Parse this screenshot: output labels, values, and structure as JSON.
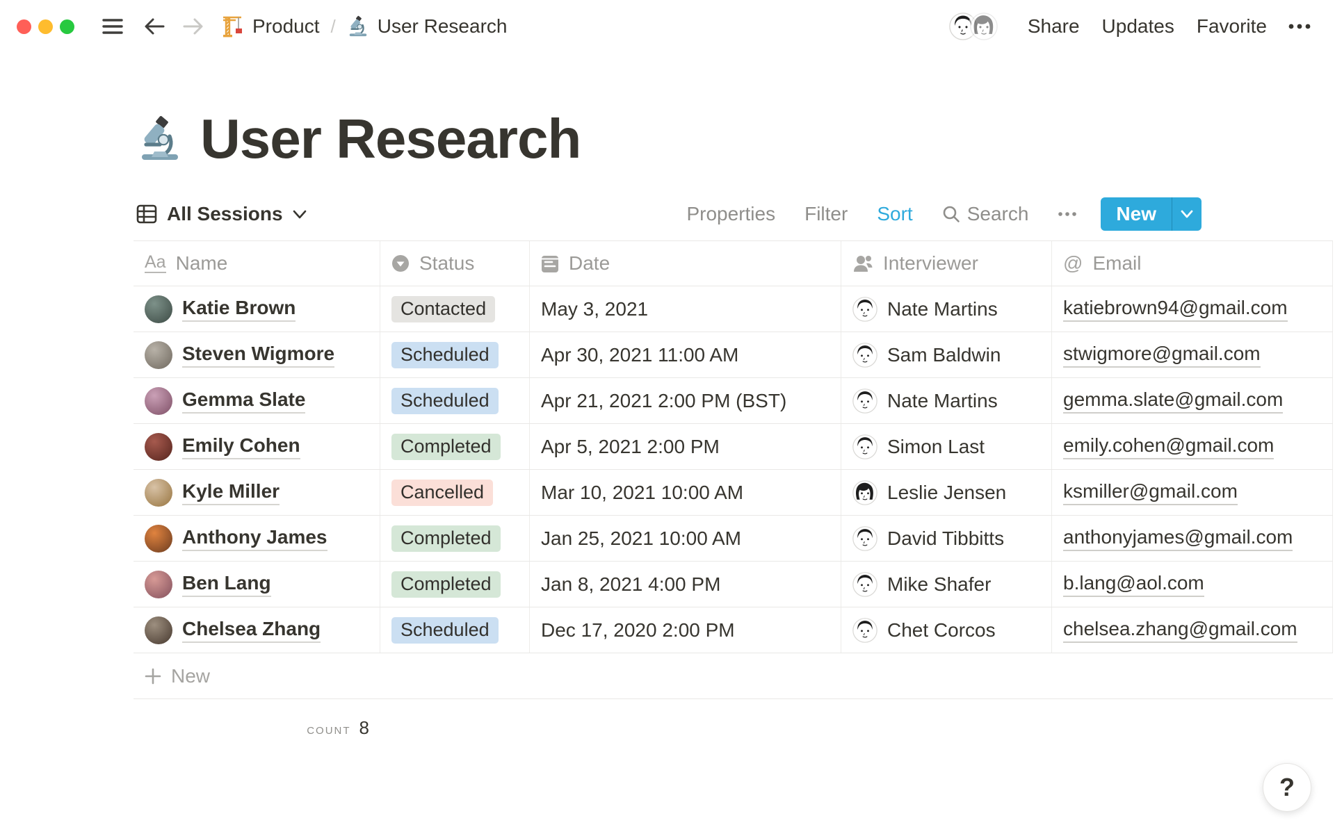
{
  "topbar": {
    "breadcrumb": [
      {
        "icon": "construction-crane",
        "label": "Product"
      },
      {
        "icon": "microscope",
        "label": "User Research"
      }
    ],
    "separator": "/",
    "actions": {
      "share": "Share",
      "updates": "Updates",
      "favorite": "Favorite"
    }
  },
  "page": {
    "icon": "microscope",
    "title": "User Research"
  },
  "view": {
    "icon": "table-grid",
    "name": "All Sessions",
    "toolbar": {
      "properties": "Properties",
      "filter": "Filter",
      "sort": "Sort",
      "search": "Search",
      "new": "New"
    },
    "active_tool": "Sort"
  },
  "table": {
    "columns": [
      {
        "label": "Name",
        "icon": "text-type"
      },
      {
        "label": "Status",
        "icon": "select-dropdown"
      },
      {
        "label": "Date",
        "icon": "calendar"
      },
      {
        "label": "Interviewer",
        "icon": "person"
      },
      {
        "label": "Email",
        "icon": "at-sign"
      }
    ],
    "rows": [
      {
        "name": "Katie Brown",
        "status": "Contacted",
        "status_color": "gray",
        "date": "May 3, 2021",
        "interviewer": "Nate Martins",
        "interviewer_avatar": "m",
        "email": "katiebrown94@gmail.com",
        "avatar": [
          "#7d9189",
          "#3c4a44"
        ]
      },
      {
        "name": "Steven Wigmore",
        "status": "Scheduled",
        "status_color": "blue",
        "date": "Apr 30, 2021 11:00 AM",
        "interviewer": "Sam Baldwin",
        "interviewer_avatar": "m",
        "email": "stwigmore@gmail.com",
        "avatar": [
          "#b8b2a8",
          "#6f685e"
        ]
      },
      {
        "name": "Gemma Slate",
        "status": "Scheduled",
        "status_color": "blue",
        "date": "Apr 21, 2021 2:00 PM (BST)",
        "interviewer": "Nate Martins",
        "interviewer_avatar": "m",
        "email": "gemma.slate@gmail.com",
        "avatar": [
          "#caa0b6",
          "#7e4f66"
        ]
      },
      {
        "name": "Emily Cohen",
        "status": "Completed",
        "status_color": "green",
        "date": "Apr 5, 2021 2:00 PM",
        "interviewer": "Simon Last",
        "interviewer_avatar": "m",
        "email": "emily.cohen@gmail.com",
        "avatar": [
          "#a65a4e",
          "#56241d"
        ]
      },
      {
        "name": "Kyle Miller",
        "status": "Cancelled",
        "status_color": "red",
        "date": "Mar 10, 2021 10:00 AM",
        "interviewer": "Leslie Jensen",
        "interviewer_avatar": "f",
        "email": "ksmiller@gmail.com",
        "avatar": [
          "#d8c2a6",
          "#97743f"
        ]
      },
      {
        "name": "Anthony James",
        "status": "Completed",
        "status_color": "green",
        "date": "Jan 25, 2021 10:00 AM",
        "interviewer": "David Tibbitts",
        "interviewer_avatar": "m",
        "email": "anthonyjames@gmail.com",
        "avatar": [
          "#e0833f",
          "#6b3b1f"
        ]
      },
      {
        "name": "Ben Lang",
        "status": "Completed",
        "status_color": "green",
        "date": "Jan 8, 2021 4:00 PM",
        "interviewer": "Mike Shafer",
        "interviewer_avatar": "m",
        "email": "b.lang@aol.com",
        "avatar": [
          "#d79a96",
          "#83505c"
        ]
      },
      {
        "name": "Chelsea Zhang",
        "status": "Scheduled",
        "status_color": "blue",
        "date": "Dec 17, 2020 2:00 PM",
        "interviewer": "Chet Corcos",
        "interviewer_avatar": "m",
        "email": "chelsea.zhang@gmail.com",
        "avatar": [
          "#9d8f7f",
          "#46382e"
        ]
      }
    ],
    "new_row_label": "New",
    "footer": {
      "label": "COUNT",
      "value": "8"
    }
  },
  "help": {
    "label": "?"
  },
  "colors": {
    "accent_blue": "#2EAADC",
    "text": "#37352F",
    "muted_text": "#8F8E8B",
    "badge_gray": "#E5E4E1",
    "badge_blue": "#CBDFF2",
    "badge_green": "#D5E7D7",
    "badge_red": "#FBDFD8",
    "traffic_red": "#FF5F57",
    "traffic_yellow": "#FEBC2E",
    "traffic_green": "#27C93F",
    "row_border": "#E9E8E6"
  }
}
